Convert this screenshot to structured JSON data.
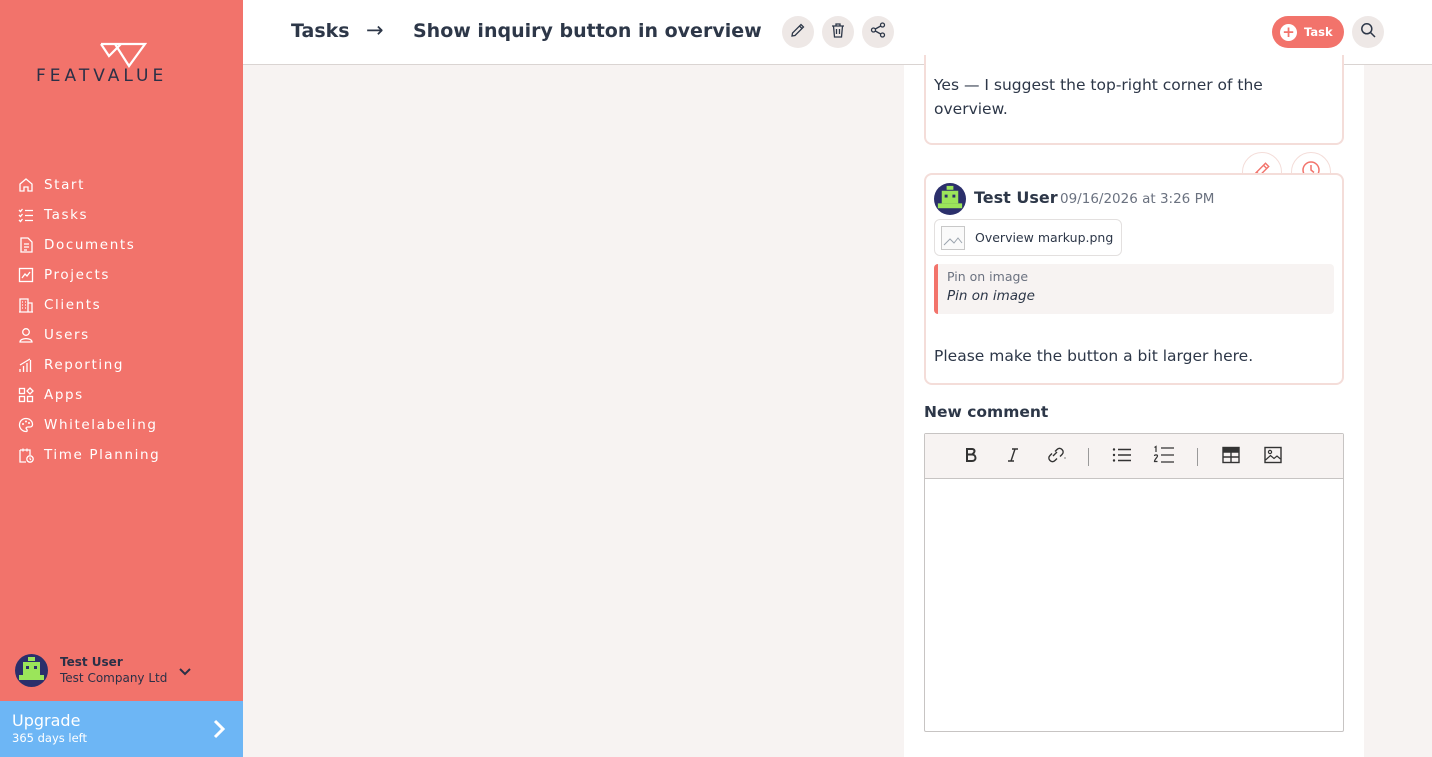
{
  "brand": {
    "logo_text": "FEATVALUE",
    "primary_color": "#f2736b",
    "upgrade_color": "#6db6f5"
  },
  "sidebar": {
    "items": [
      {
        "label": "Start",
        "icon": "home-icon"
      },
      {
        "label": "Tasks",
        "icon": "tasks-icon"
      },
      {
        "label": "Documents",
        "icon": "documents-icon"
      },
      {
        "label": "Projects",
        "icon": "projects-icon"
      },
      {
        "label": "Clients",
        "icon": "clients-icon"
      },
      {
        "label": "Users",
        "icon": "user-icon"
      },
      {
        "label": "Reporting",
        "icon": "reporting-icon"
      },
      {
        "label": "Apps",
        "icon": "apps-icon"
      },
      {
        "label": "Whitelabeling",
        "icon": "palette-icon"
      },
      {
        "label": "Time Planning",
        "icon": "time-planning-icon"
      }
    ],
    "user": {
      "name": "Test User",
      "company": "Test Company Ltd"
    },
    "upgrade": {
      "title": "Upgrade",
      "subtitle": "365 days left"
    }
  },
  "header": {
    "breadcrumb_root": "Tasks",
    "breadcrumb_arrow": "→",
    "breadcrumb_current": "Show inquiry button in overview",
    "new_task_label": "Task"
  },
  "comments": {
    "previous": {
      "text": "Yes — I suggest the top-right corner of the overview."
    },
    "latest": {
      "author": "Test User",
      "date": "09/16/2026 at 3:26 PM",
      "attachment": "Overview markup.png",
      "quote_title": "Pin on image",
      "quote_text": "Pin on image",
      "body": "Please make the button a bit larger here."
    },
    "new_comment_label": "New comment"
  }
}
